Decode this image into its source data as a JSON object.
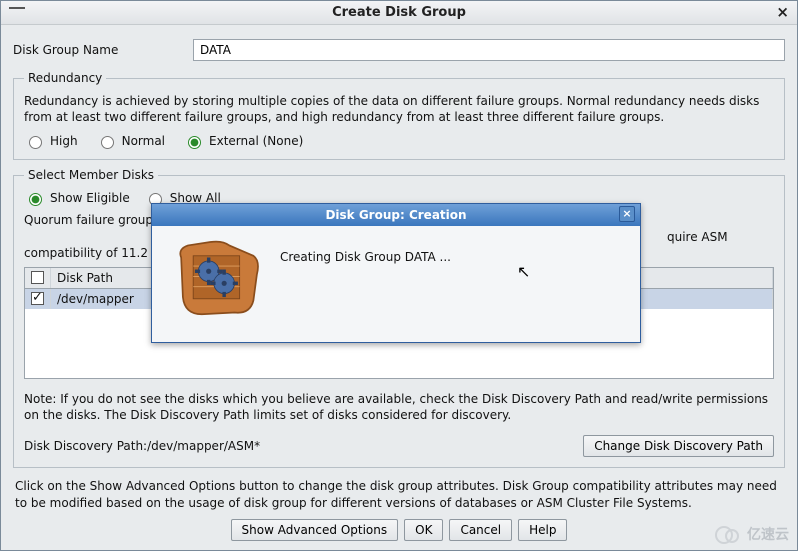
{
  "window": {
    "title": "Create Disk Group"
  },
  "form": {
    "disk_group_name_label": "Disk Group Name",
    "disk_group_name_value": "DATA"
  },
  "redundancy": {
    "legend": "Redundancy",
    "description": "Redundancy is achieved by storing multiple copies of the data on different failure groups. Normal redundancy needs disks from at least two different failure groups, and high redundancy from at least three different failure groups.",
    "options": {
      "high": "High",
      "normal": "Normal",
      "external": "External (None)"
    },
    "selected": "external"
  },
  "member_disks": {
    "legend": "Select Member Disks",
    "filter": {
      "eligible": "Show Eligible",
      "all": "Show All",
      "selected": "eligible"
    },
    "quorum_note_prefix": "Quorum failure group",
    "quorum_note_suffix": "quire ASM compatibility of 11.2 o",
    "columns": {
      "disk_path": "Disk Path"
    },
    "rows": [
      {
        "checked": true,
        "disk_path": "/dev/mapper"
      }
    ],
    "note": "Note: If you do not see the disks which you believe are available, check the Disk Discovery Path and read/write permissions on the disks. The Disk Discovery Path limits set of disks considered for discovery.",
    "discovery_path_label": "Disk Discovery Path:",
    "discovery_path_value": "/dev/mapper/ASM*",
    "change_btn": "Change Disk Discovery Path"
  },
  "footer": {
    "note": "Click on the Show Advanced Options button to change the disk group attributes. Disk Group compatibility attributes may need to be modified based on the usage of disk group for different versions of databases or ASM Cluster File Systems.",
    "buttons": {
      "advanced": "Show Advanced Options",
      "ok": "OK",
      "cancel": "Cancel",
      "help": "Help"
    }
  },
  "modal": {
    "title": "Disk Group: Creation",
    "message": "Creating Disk Group DATA ..."
  },
  "watermark": "亿速云"
}
